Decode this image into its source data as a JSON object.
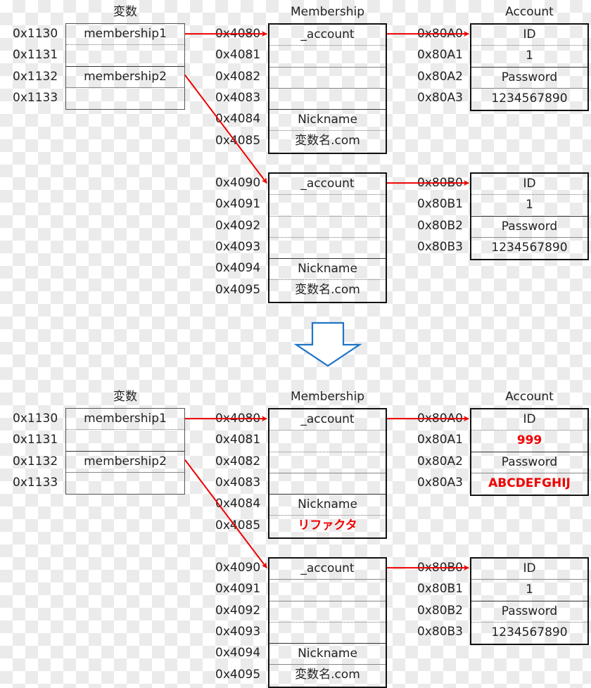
{
  "colors": {
    "pointer_arrow": "#ee0000",
    "changed_text": "#ee0000",
    "transition_arrow": "#1f74c4"
  },
  "transition_arrow_icon": "down-arrow-outline",
  "states": [
    {
      "name": "before",
      "variables": {
        "title": "変数",
        "rows": [
          {
            "addr": "0x1130",
            "value": "membership1",
            "divider": "dot"
          },
          {
            "addr": "0x1131",
            "value": "",
            "divider": "solid"
          },
          {
            "addr": "0x1132",
            "value": "membership2",
            "divider": "gray"
          },
          {
            "addr": "0x1133",
            "value": "",
            "divider": "none"
          }
        ]
      },
      "memberships": [
        {
          "title": "Membership",
          "rows": [
            {
              "addr": "0x4080",
              "value": "_account",
              "divider": "dot"
            },
            {
              "addr": "0x4081",
              "value": "",
              "divider": "gray"
            },
            {
              "addr": "0x4082",
              "value": "",
              "divider": "gray"
            },
            {
              "addr": "0x4083",
              "value": "",
              "divider": "solid"
            },
            {
              "addr": "0x4084",
              "value": "Nickname",
              "divider": "dot"
            },
            {
              "addr": "0x4085",
              "value": "変数名.com",
              "divider": "none"
            }
          ]
        },
        {
          "title": "",
          "rows": [
            {
              "addr": "0x4090",
              "value": "_account",
              "divider": "dot"
            },
            {
              "addr": "0x4091",
              "value": "",
              "divider": "dot"
            },
            {
              "addr": "0x4092",
              "value": "",
              "divider": "dot"
            },
            {
              "addr": "0x4093",
              "value": "",
              "divider": "solid"
            },
            {
              "addr": "0x4094",
              "value": "Nickname",
              "divider": "dot"
            },
            {
              "addr": "0x4095",
              "value": "変数名.com",
              "divider": "none"
            }
          ]
        }
      ],
      "accounts": [
        {
          "title": "Account",
          "rows": [
            {
              "addr": "0x80A0",
              "value": "ID",
              "divider": "dot"
            },
            {
              "addr": "0x80A1",
              "value": "1",
              "divider": "solid"
            },
            {
              "addr": "0x80A2",
              "value": "Password",
              "divider": "gray"
            },
            {
              "addr": "0x80A3",
              "value": "1234567890",
              "divider": "none"
            }
          ]
        },
        {
          "title": "",
          "rows": [
            {
              "addr": "0x80B0",
              "value": "ID",
              "divider": "dot"
            },
            {
              "addr": "0x80B1",
              "value": "1",
              "divider": "solid"
            },
            {
              "addr": "0x80B2",
              "value": "Password",
              "divider": "gray"
            },
            {
              "addr": "0x80B3",
              "value": "1234567890",
              "divider": "none"
            }
          ]
        }
      ]
    },
    {
      "name": "after",
      "variables": {
        "title": "変数",
        "rows": [
          {
            "addr": "0x1130",
            "value": "membership1",
            "divider": "dot"
          },
          {
            "addr": "0x1131",
            "value": "",
            "divider": "solid"
          },
          {
            "addr": "0x1132",
            "value": "membership2",
            "divider": "gray"
          },
          {
            "addr": "0x1133",
            "value": "",
            "divider": "none"
          }
        ]
      },
      "memberships": [
        {
          "title": "Membership",
          "rows": [
            {
              "addr": "0x4080",
              "value": "_account",
              "divider": "dot"
            },
            {
              "addr": "0x4081",
              "value": "",
              "divider": "dot"
            },
            {
              "addr": "0x4082",
              "value": "",
              "divider": "gray"
            },
            {
              "addr": "0x4083",
              "value": "",
              "divider": "solid"
            },
            {
              "addr": "0x4084",
              "value": "Nickname",
              "divider": "dot"
            },
            {
              "addr": "0x4085",
              "value": "リファクタ",
              "divider": "none",
              "changed": true
            }
          ]
        },
        {
          "title": "",
          "rows": [
            {
              "addr": "0x4090",
              "value": "_account",
              "divider": "gray"
            },
            {
              "addr": "0x4091",
              "value": "",
              "divider": "gray"
            },
            {
              "addr": "0x4092",
              "value": "",
              "divider": "dot"
            },
            {
              "addr": "0x4093",
              "value": "",
              "divider": "solid"
            },
            {
              "addr": "0x4094",
              "value": "Nickname",
              "divider": "gray"
            },
            {
              "addr": "0x4095",
              "value": "変数名.com",
              "divider": "none"
            }
          ]
        }
      ],
      "accounts": [
        {
          "title": "Account",
          "rows": [
            {
              "addr": "0x80A0",
              "value": "ID",
              "divider": "dot"
            },
            {
              "addr": "0x80A1",
              "value": "999",
              "divider": "solid",
              "changed": true
            },
            {
              "addr": "0x80A2",
              "value": "Password",
              "divider": "gray"
            },
            {
              "addr": "0x80A3",
              "value": "ABCDEFGHIJ",
              "divider": "none",
              "changed": true
            }
          ]
        },
        {
          "title": "",
          "rows": [
            {
              "addr": "0x80B0",
              "value": "ID",
              "divider": "gray"
            },
            {
              "addr": "0x80B1",
              "value": "1",
              "divider": "solid"
            },
            {
              "addr": "0x80B2",
              "value": "Password",
              "divider": "dot"
            },
            {
              "addr": "0x80B3",
              "value": "1234567890",
              "divider": "none"
            }
          ]
        }
      ]
    }
  ]
}
